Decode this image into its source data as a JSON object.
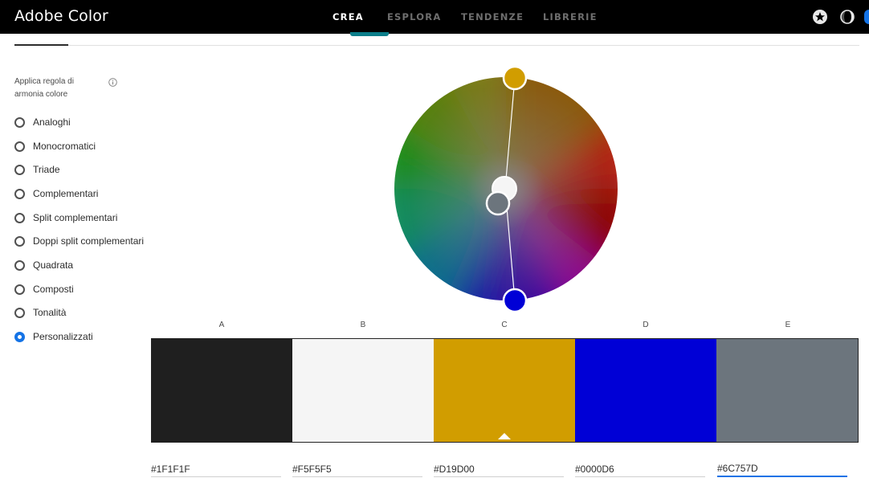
{
  "app": {
    "title": "Adobe Color"
  },
  "nav": {
    "tabs": [
      {
        "label": "CREA",
        "active": true
      },
      {
        "label": "ESPLORA",
        "active": false
      },
      {
        "label": "TENDENZE",
        "active": false
      },
      {
        "label": "LIBRERIE",
        "active": false
      }
    ],
    "icons": [
      "star-icon",
      "theme-toggle-icon",
      "user-avatar"
    ]
  },
  "harmony": {
    "heading": "Applica regola di armonia colore",
    "options": [
      {
        "label": "Analoghi",
        "selected": false
      },
      {
        "label": "Monocromatici",
        "selected": false
      },
      {
        "label": "Triade",
        "selected": false
      },
      {
        "label": "Complementari",
        "selected": false
      },
      {
        "label": "Split complementari",
        "selected": false
      },
      {
        "label": "Doppi split complementari",
        "selected": false
      },
      {
        "label": "Quadrata",
        "selected": false
      },
      {
        "label": "Composti",
        "selected": false
      },
      {
        "label": "Tonalità",
        "selected": false
      },
      {
        "label": "Personalizzati",
        "selected": true
      }
    ]
  },
  "swatches": [
    {
      "letter": "A",
      "hex": "#1F1F1F",
      "color": "#1f1f1f",
      "base": false
    },
    {
      "letter": "B",
      "hex": "#F5F5F5",
      "color": "#f5f5f5",
      "base": false
    },
    {
      "letter": "C",
      "hex": "#D19D00",
      "color": "#d19d00",
      "base": true
    },
    {
      "letter": "D",
      "hex": "#0000D6",
      "color": "#0000d6",
      "base": false
    },
    {
      "letter": "E",
      "hex": "#6C757D",
      "color": "#6c757d",
      "base": false,
      "focused": true
    }
  ],
  "colors": {
    "accent": "#1473e6",
    "tab_indicator": "#0b7e8a",
    "topbar": "#000000"
  }
}
